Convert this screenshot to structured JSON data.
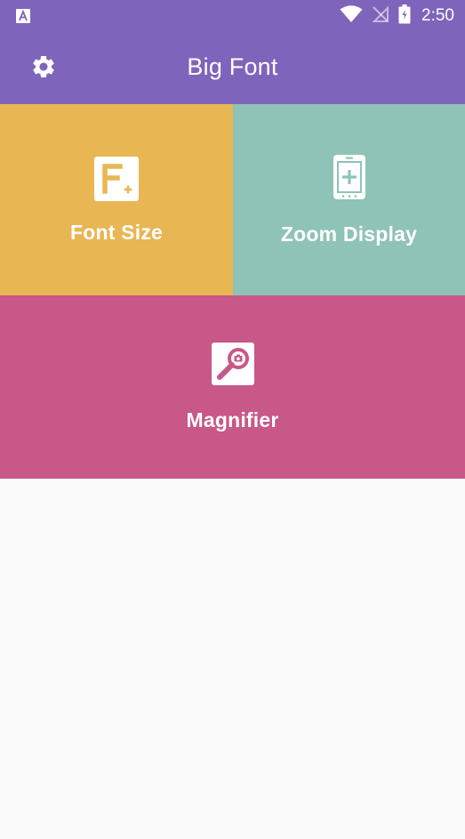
{
  "status_bar": {
    "time": "2:50",
    "notification_icon": "app-notification-icon",
    "wifi_icon": "wifi-icon",
    "signal_icon": "no-signal-icon",
    "battery_icon": "battery-charging-icon"
  },
  "app_bar": {
    "title": "Big Font",
    "settings_icon": "gear-icon"
  },
  "tiles": [
    {
      "label": "Font Size",
      "icon": "font-size-icon",
      "color": "#e8b653"
    },
    {
      "label": "Zoom Display",
      "icon": "zoom-display-icon",
      "color": "#8fc3b8"
    },
    {
      "label": "Magnifier",
      "icon": "magnifier-icon",
      "color": "#c85887"
    }
  ],
  "colors": {
    "primary": "#7f64bb",
    "background": "#fafafa"
  }
}
